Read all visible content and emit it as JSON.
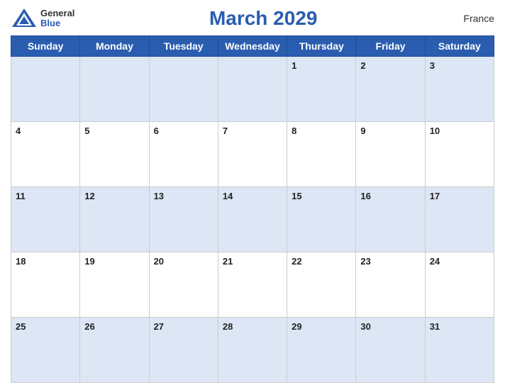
{
  "header": {
    "title": "March 2029",
    "country": "France",
    "logo_general": "General",
    "logo_blue": "Blue"
  },
  "days_of_week": [
    "Sunday",
    "Monday",
    "Tuesday",
    "Wednesday",
    "Thursday",
    "Friday",
    "Saturday"
  ],
  "weeks": [
    [
      null,
      null,
      null,
      null,
      1,
      2,
      3
    ],
    [
      4,
      5,
      6,
      7,
      8,
      9,
      10
    ],
    [
      11,
      12,
      13,
      14,
      15,
      16,
      17
    ],
    [
      18,
      19,
      20,
      21,
      22,
      23,
      24
    ],
    [
      25,
      26,
      27,
      28,
      29,
      30,
      31
    ]
  ]
}
